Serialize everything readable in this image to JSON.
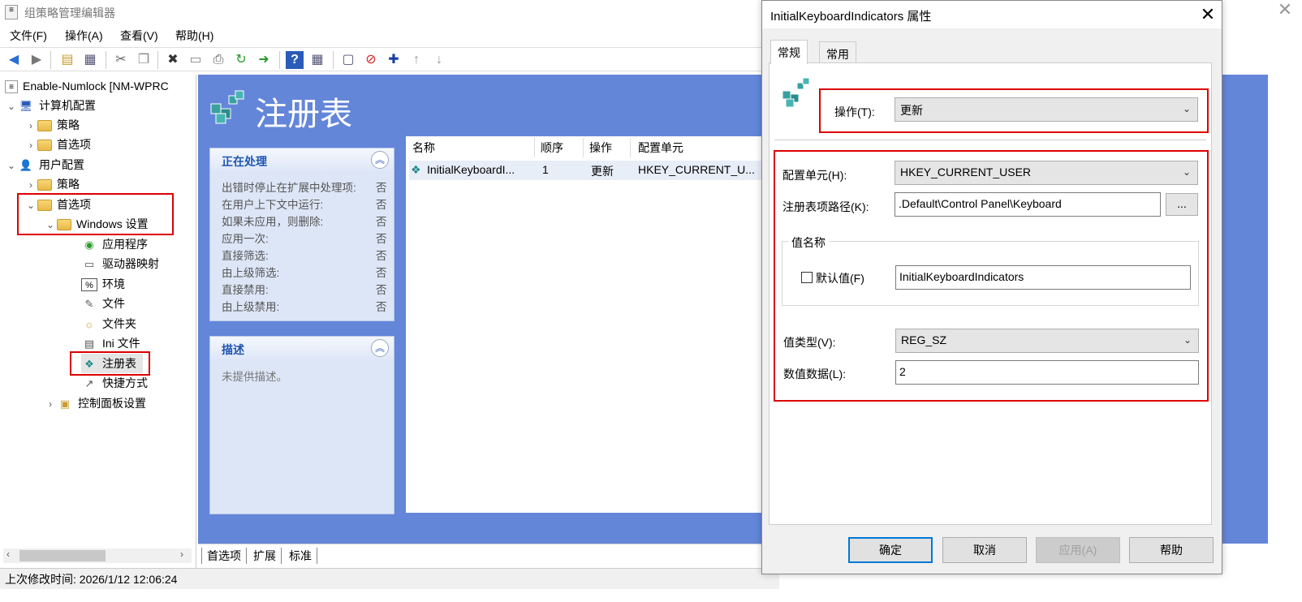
{
  "app": {
    "title": "组策略管理编辑器",
    "close": "✕"
  },
  "menu": [
    "文件(F)",
    "操作(A)",
    "查看(V)",
    "帮助(H)"
  ],
  "tree": {
    "root": "Enable-Numlock [NM-WPRC",
    "computer_config": "计算机配置",
    "c_policy": "策略",
    "c_prefs": "首选项",
    "user_config": "用户配置",
    "u_policy": "策略",
    "u_prefs": "首选项",
    "windows_settings": "Windows 设置",
    "items": [
      "应用程序",
      "驱动器映射",
      "环境",
      "文件",
      "文件夹",
      "Ini 文件",
      "注册表",
      "快捷方式"
    ],
    "control_panel": "控制面板设置"
  },
  "status": "上次修改时间: 2026/1/12 12:06:24",
  "main": {
    "title": "注册表",
    "processing": {
      "header": "正在处理",
      "rows": [
        {
          "label": "出错时停止在扩展中处理项:",
          "value": "否"
        },
        {
          "label": "在用户上下文中运行:",
          "value": "否"
        },
        {
          "label": "如果未应用，则删除:",
          "value": "否"
        },
        {
          "label": "应用一次:",
          "value": "否"
        },
        {
          "label": "直接筛选:",
          "value": "否"
        },
        {
          "label": "由上级筛选:",
          "value": "否"
        },
        {
          "label": "直接禁用:",
          "value": "否"
        },
        {
          "label": "由上级禁用:",
          "value": "否"
        }
      ]
    },
    "description": {
      "header": "描述",
      "text": "未提供描述。"
    },
    "columns": [
      "名称",
      "顺序",
      "操作",
      "配置单元"
    ],
    "row": {
      "name": "InitialKeyboardI...",
      "order": "1",
      "action": "更新",
      "hive": "HKEY_CURRENT_U..."
    },
    "bottom_tabs": [
      "首选项",
      "扩展",
      "标准"
    ]
  },
  "dialog": {
    "title": "InitialKeyboardIndicators 属性",
    "close": "✕",
    "tabs": [
      "常规",
      "常用"
    ],
    "action_label": "操作(T):",
    "action_value": "更新",
    "hive_label": "配置单元(H):",
    "hive_value": "HKEY_CURRENT_USER",
    "key_path_label": "注册表项路径(K):",
    "key_path_value": ".Default\\Control Panel\\Keyboard",
    "browse": "...",
    "value_name_group": "值名称",
    "default_value_label": "默认值(F)",
    "value_name": "InitialKeyboardIndicators",
    "value_type_label": "值类型(V):",
    "value_type": "REG_SZ",
    "value_data_label": "数值数据(L):",
    "value_data": "2",
    "buttons": {
      "ok": "确定",
      "cancel": "取消",
      "apply": "应用(A)",
      "help": "帮助"
    }
  },
  "colors": {
    "accent": "#6486d9",
    "highlight_box": "#dd0000",
    "link": "#1f55b0"
  }
}
